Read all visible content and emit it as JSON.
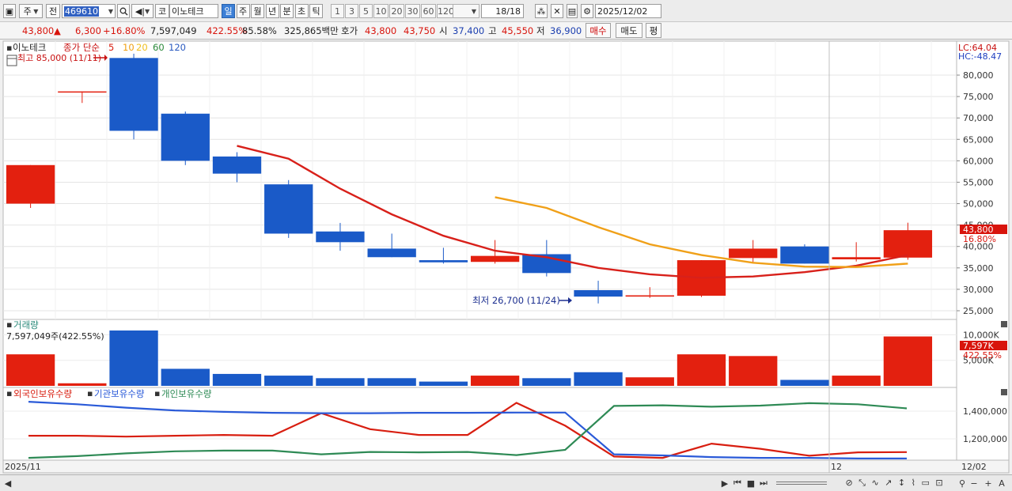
{
  "toolbar": {
    "period_unit": "주",
    "prev_label": "전",
    "stock_code": "469610",
    "market_label": "코",
    "stock_name": "이노테크",
    "tabs": [
      "일",
      "주",
      "월",
      "년",
      "분",
      "초",
      "틱"
    ],
    "active_tab": "일",
    "intervals": [
      "1",
      "3",
      "5",
      "10",
      "20",
      "30",
      "60",
      "120"
    ],
    "count": "18/18",
    "date": "2025/12/02"
  },
  "quote": {
    "price": "43,800",
    "change_arrow": "▲",
    "change": "6,300",
    "change_pct": "+16.80%",
    "volume": "7,597,049",
    "volume_ratio": "422.55%",
    "turnover": "85.58%",
    "amount": "325,865백만",
    "hoga_label": "호가",
    "ask": "43,800",
    "bid": "43,750",
    "open_label": "시",
    "open": "37,400",
    "high_label": "고",
    "high": "45,550",
    "low_label": "저",
    "low": "36,900",
    "buy_button": "매수",
    "sell_button": "매도",
    "eval_button": "평"
  },
  "price_panel": {
    "stock_name": "이노테크",
    "ma_legend_prefix": "종가 단순",
    "ma_periods": [
      "5",
      "10",
      "20",
      "60",
      "120"
    ],
    "ma_colors": [
      "#d81e10",
      "#f0a010",
      "#f0c020",
      "#2a8a3a",
      "#2a5ac0"
    ],
    "high_marker": "최고 85,000 (11/11)",
    "low_marker": "최저 26,700 (11/24)",
    "lc_label": "LC:64.04",
    "hc_label": "HC:-48.47",
    "current_price_tag": "43,800",
    "current_pct_tag": "16.80%"
  },
  "volume_panel": {
    "title": "거래량",
    "info": "7,597,049주(422.55%)",
    "tag_value": "7,597K",
    "tag_pct": "422.55%"
  },
  "holding_panel": {
    "legend": [
      "외국인보유수량",
      "기관보유수량",
      "개인보유수량"
    ],
    "colors": [
      "#d81e10",
      "#2a5ad8",
      "#2e8a55"
    ]
  },
  "x_axis": {
    "left_label": "2025/11",
    "mid_label": "12",
    "right_label": "12/02"
  },
  "chart_data": {
    "type": "candlestick",
    "price_axis_ticks": [
      80000,
      75000,
      70000,
      65000,
      60000,
      55000,
      50000,
      45000,
      40000,
      35000,
      30000,
      25000
    ],
    "price_axis_labels": [
      "80,000",
      "75,000",
      "70,000",
      "65,000",
      "60,000",
      "55,000",
      "50,000",
      "45,000",
      "40,000",
      "35,000",
      "30,000",
      "25,000"
    ],
    "candles": [
      {
        "o": 50000,
        "c": 59000,
        "h": 59000,
        "l": 49000
      },
      {
        "o": 76200,
        "c": 76200,
        "h": 76200,
        "l": 73500
      },
      {
        "o": 84000,
        "c": 67000,
        "h": 85000,
        "l": 65000
      },
      {
        "o": 71000,
        "c": 60000,
        "h": 71500,
        "l": 59000
      },
      {
        "o": 61000,
        "c": 57000,
        "h": 62000,
        "l": 55000
      },
      {
        "o": 54500,
        "c": 43000,
        "h": 55500,
        "l": 42000
      },
      {
        "o": 43500,
        "c": 41000,
        "h": 45500,
        "l": 39000
      },
      {
        "o": 39500,
        "c": 37500,
        "h": 43000,
        "l": 37500
      },
      {
        "o": 36800,
        "c": 36300,
        "h": 39700,
        "l": 36000
      },
      {
        "o": 36400,
        "c": 37800,
        "h": 41500,
        "l": 36000
      },
      {
        "o": 38200,
        "c": 33800,
        "h": 41500,
        "l": 33000
      },
      {
        "o": 29800,
        "c": 28300,
        "h": 32000,
        "l": 26700
      },
      {
        "o": 28300,
        "c": 28600,
        "h": 30500,
        "l": 28000
      },
      {
        "o": 28500,
        "c": 36800,
        "h": 36800,
        "l": 28200
      },
      {
        "o": 37300,
        "c": 39500,
        "h": 41500,
        "l": 36000
      },
      {
        "o": 40000,
        "c": 36000,
        "h": 40500,
        "l": 36000
      },
      {
        "o": 37000,
        "c": 37500,
        "h": 41000,
        "l": 36500
      },
      {
        "o": 37400,
        "c": 43800,
        "h": 45550,
        "l": 36900
      }
    ],
    "ma5": [
      null,
      null,
      null,
      null,
      63500,
      60500,
      53500,
      47500,
      42500,
      39000,
      37500,
      35000,
      33500,
      32700,
      33000,
      34000,
      35500,
      38000
    ],
    "ma10": [
      null,
      null,
      null,
      null,
      null,
      null,
      null,
      null,
      null,
      51500,
      49000,
      44500,
      40500,
      38000,
      36200,
      35300,
      35200,
      36000
    ],
    "volume_axis_labels": [
      "10,000K",
      "5,000K"
    ],
    "volume": [
      3700,
      300,
      6500,
      2000,
      1400,
      1200,
      900,
      900,
      500,
      1200,
      900,
      1600,
      1000,
      3700,
      3500,
      700,
      1200,
      5800
    ],
    "volume_up": [
      true,
      true,
      false,
      false,
      false,
      false,
      false,
      false,
      false,
      true,
      false,
      false,
      true,
      true,
      true,
      false,
      true,
      true
    ],
    "holding_axis_labels": [
      "1,400,000",
      "1,200,000"
    ],
    "holding_series": [
      {
        "name": "외국인보유수량",
        "values": [
          1222000,
          1222000,
          1216000,
          1222000,
          1228000,
          1222000,
          1385000,
          1270000,
          1228000,
          1228000,
          1460000,
          1295000,
          1072000,
          1062000,
          1165000,
          1128000,
          1078000,
          1102000,
          1104000
        ]
      },
      {
        "name": "기관보유수량",
        "values": [
          1468000,
          1450000,
          1425000,
          1405000,
          1395000,
          1388000,
          1385000,
          1385000,
          1388000,
          1388000,
          1390000,
          1390000,
          1088000,
          1080000,
          1068000,
          1062000,
          1062000,
          1058000,
          1058000
        ]
      },
      {
        "name": "개인보유수량",
        "values": [
          1062000,
          1075000,
          1095000,
          1110000,
          1115000,
          1115000,
          1088000,
          1105000,
          1102000,
          1105000,
          1082000,
          1120000,
          1438000,
          1442000,
          1432000,
          1440000,
          1458000,
          1450000,
          1420000
        ]
      }
    ]
  }
}
